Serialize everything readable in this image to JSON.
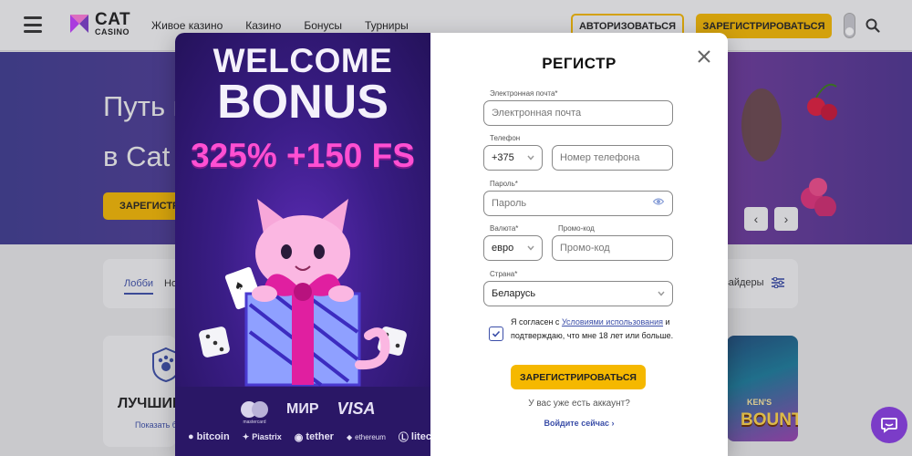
{
  "header": {
    "logo_main": "CAT",
    "logo_sub": "CASINO",
    "nav": [
      "Живое казино",
      "Казино",
      "Бонусы",
      "Турниры"
    ],
    "login_label": "АВТОРИЗОВАТЬСЯ",
    "register_label": "ЗАРЕГИСТРИРОВАТЬСЯ"
  },
  "hero": {
    "title_line1": "Путь к",
    "title_line2": "в Cat",
    "button_label": "ЗАРЕГИСТРИ",
    "prev": "‹",
    "next": "›"
  },
  "lobby": {
    "tab_active": "Лобби",
    "tab_next": "Но",
    "providers_label": "вайдеры"
  },
  "promo": {
    "title": "ЛУЧШИЕ",
    "link": "Показать б"
  },
  "game": {
    "sub": "KEN'S",
    "title": "BOUNTY"
  },
  "bonus": {
    "welcome": "WELCOME",
    "bonus": "BONUS",
    "amount": "325% +150 FS",
    "payments_row1": [
      "mastercard",
      "МИР",
      "VISA"
    ],
    "payments_row2": [
      "bitcoin",
      "Piastrix",
      "tether",
      "ethereum",
      "litecoin"
    ]
  },
  "form": {
    "title": "РЕГИСТР",
    "email_label": "Электронная почта*",
    "email_placeholder": "Электронная почта",
    "phone_label": "Телефон",
    "phone_code": "+375",
    "phone_placeholder": "Номер телефона",
    "password_label": "Пароль*",
    "password_placeholder": "Пароль",
    "currency_label": "Валюта*",
    "currency_value": "евро",
    "promo_label": "Промо-код",
    "promo_placeholder": "Промо-код",
    "country_label": "Страна*",
    "country_value": "Беларусь",
    "agree_prefix": "Я согласен с ",
    "agree_link": "Условиями использования",
    "agree_suffix": " и подтверждаю, что мне 18 лет или больше.",
    "agree_checked": true,
    "submit_label": "ЗАРЕГИСТРИРОВАТЬСЯ",
    "have_account": "У вас уже есть аккаунт?",
    "login_link": "Войдите сейчас"
  },
  "colors": {
    "accent": "#f5b800",
    "link": "#3b4ea8",
    "bonus_pink": "#ff4fd2",
    "chat": "#7b3cc8"
  },
  "icons": {
    "menu": "burger-icon",
    "search": "search-icon",
    "close": "close-icon",
    "eye": "eye-icon",
    "chevron": "chevron-down-icon",
    "chat": "chat-icon",
    "filter": "filter-icon"
  }
}
